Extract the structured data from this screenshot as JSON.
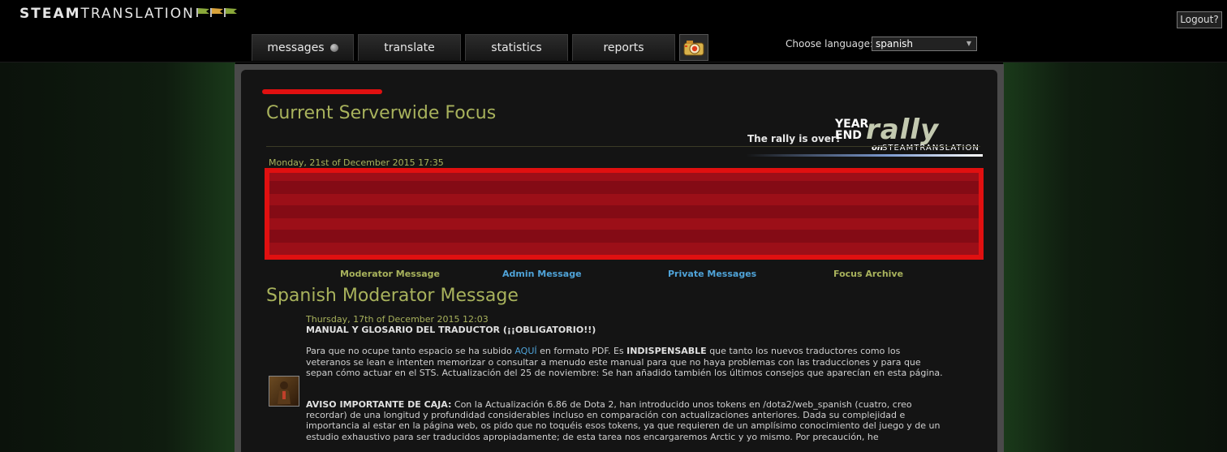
{
  "header": {
    "logo_bold": "STEAM",
    "logo_light": "TRANSLATION",
    "logout_label": "Logout?",
    "nav": {
      "messages": "messages",
      "translate": "translate",
      "statistics": "statistics",
      "reports": "reports"
    },
    "language_label": "Choose language:",
    "language_value": "spanish"
  },
  "focus": {
    "title": "Current Serverwide Focus",
    "date": "Monday, 21st of December 2015 17:35",
    "rally_over": "The rally is over!",
    "rally_year": "YEAR",
    "rally_end": "END",
    "rally_word": "rally",
    "rally_on": "on",
    "rally_brand": "STEAMTRANSLATION"
  },
  "message_tabs": {
    "moderator": "Moderator Message",
    "admin": "Admin Message",
    "private": "Private Messages",
    "archive": "Focus Archive"
  },
  "moderator_message": {
    "title": "Spanish Moderator Message",
    "date": "Thursday, 17th of December 2015 12:03",
    "subject": "MANUAL Y GLOSARIO DEL TRADUCTOR (¡¡OBLIGATORIO!!)",
    "p1_a": "Para que no ocupe tanto espacio se ha subido ",
    "p1_link": "AQUÍ",
    "p1_b": " en formato PDF. Es ",
    "p1_bold": "INDISPENSABLE",
    "p1_c": " que tanto los nuevos traductores como los veteranos se lean e intenten memorizar o consultar a menudo este manual para que no haya problemas con las traducciones y para que sepan cómo actuar en el STS. Actualización del 25 de noviembre: Se han añadido también los últimos consejos que aparecían en esta página.",
    "p2_bold": "AVISO IMPORTANTE DE CAJA:",
    "p2_text": " Con la Actualización 6.86 de Dota 2, han introducido unos tokens en /dota2/web_spanish (cuatro, creo recordar) de una longitud y profundidad considerables incluso en comparación con actualizaciones anteriores. Dada su complejidad e importancia al estar en la página web, os pido que no toquéis esos tokens, ya que requieren de un amplísimo conocimiento del juego y de un estudio exhaustivo para ser traducidos apropiadamente; de esta tarea nos encargaremos Arctic y yo mismo. Por precaución, he"
  },
  "colors": {
    "accent_olive": "#a8b25c",
    "link_blue": "#4fa3d8",
    "redaction": "#e01010"
  }
}
